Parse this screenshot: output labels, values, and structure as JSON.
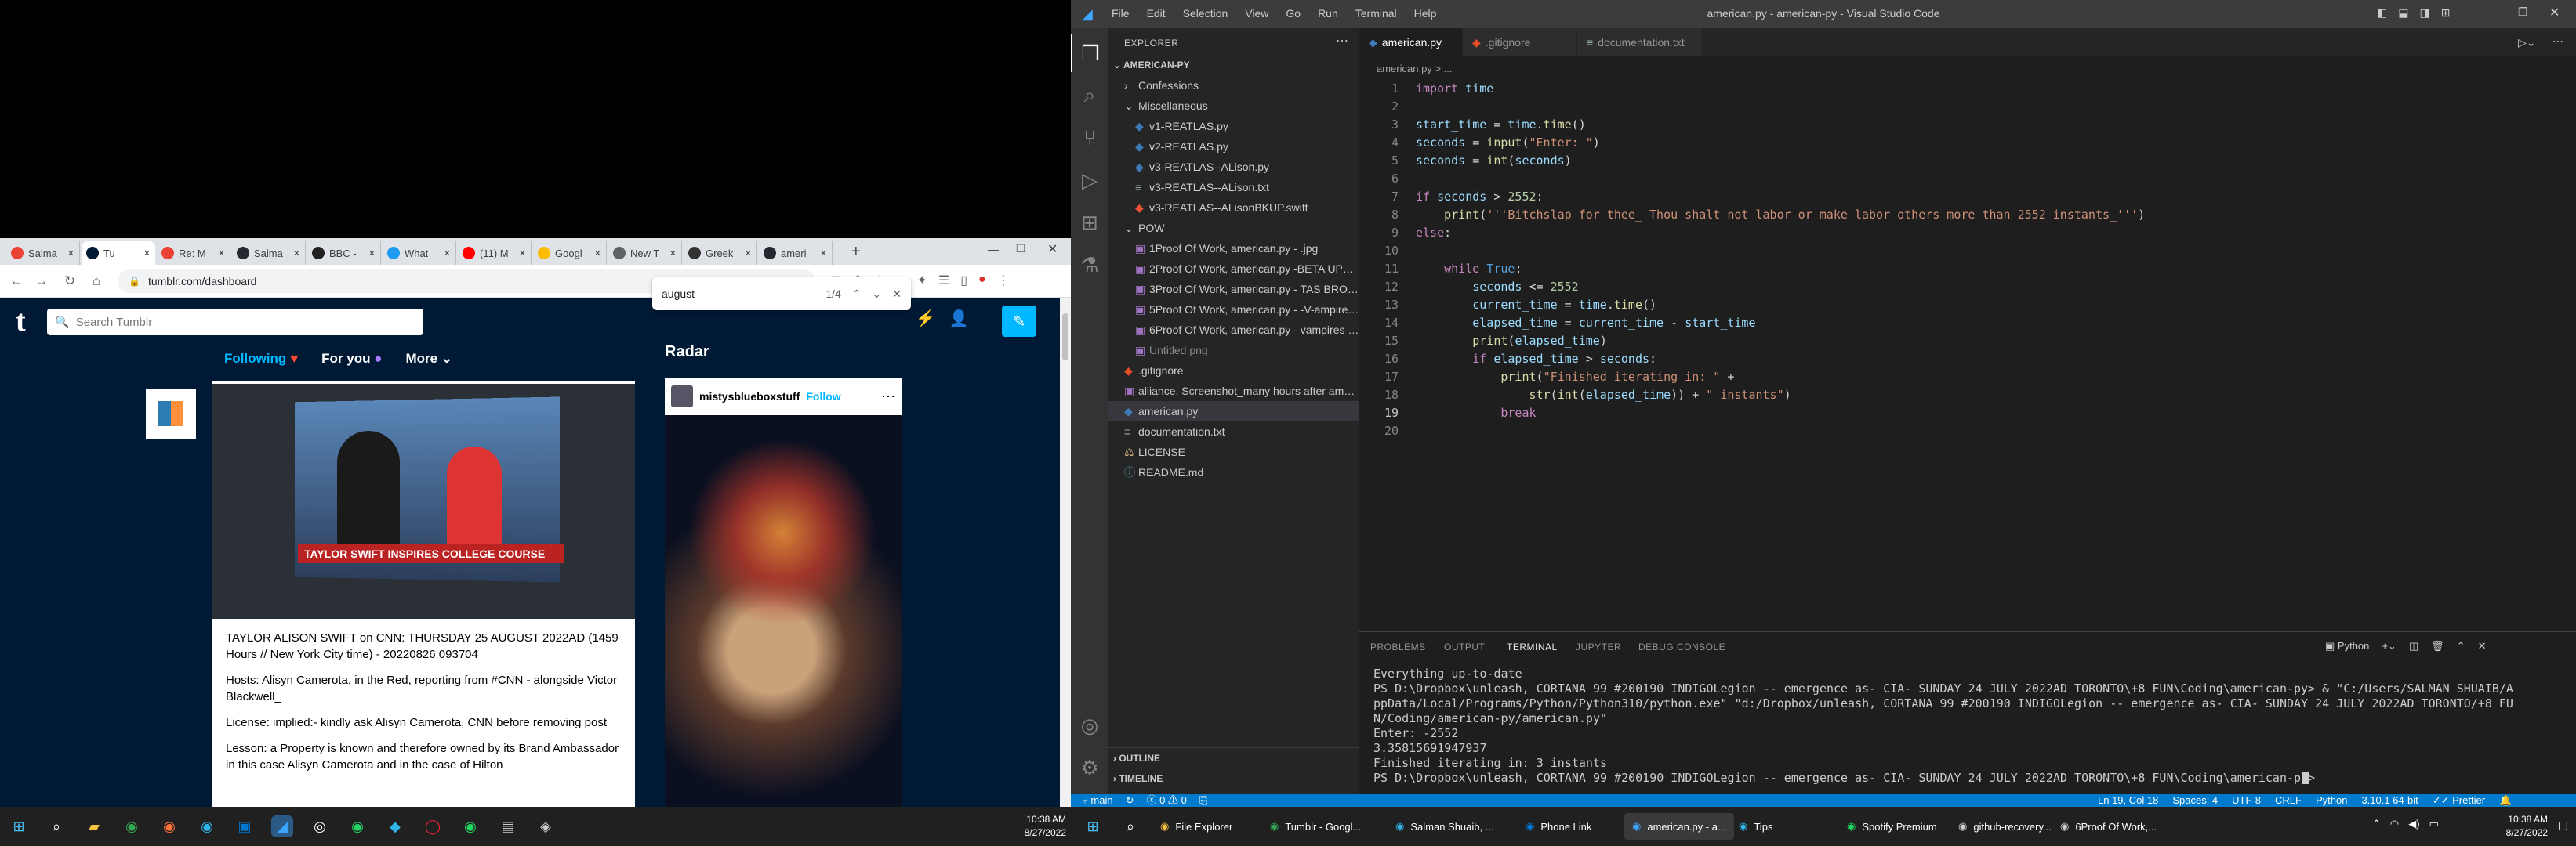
{
  "chrome": {
    "tabs": [
      {
        "label": "Salma",
        "color": "#ea4335"
      },
      {
        "label": "Tu",
        "color": "#001935"
      },
      {
        "label": "Re: M",
        "color": "#ea4335"
      },
      {
        "label": "Salma",
        "color": "#24292f"
      },
      {
        "label": "BBC -",
        "color": "#222"
      },
      {
        "label": "What",
        "color": "#1d9bf0"
      },
      {
        "label": "(11) M",
        "color": "#ff0000"
      },
      {
        "label": "Googl",
        "color": "#fbbc04"
      },
      {
        "label": "New T",
        "color": "#5f6368"
      },
      {
        "label": "Greek",
        "color": "#333"
      },
      {
        "label": "ameri",
        "color": "#24292f"
      }
    ],
    "new_tab": "+",
    "url": "tumblr.com/dashboard",
    "find": {
      "query": "august",
      "count": "1/4"
    }
  },
  "tumblr": {
    "search_placeholder": "Search Tumblr",
    "nav": {
      "following": "Following",
      "for_you": "For you",
      "more": "More"
    },
    "radar_title": "Radar",
    "radar_user": "mistysblueboxstuff",
    "radar_follow": "Follow",
    "tv_banner": "TAYLOR SWIFT INSPIRES COLLEGE COURSE",
    "post_paragraphs": [
      "TAYLOR ALISON SWIFT on CNN: THURSDAY 25 AUGUST 2022AD (1459 Hours // New York City time) - 20220826 093704",
      "Hosts: Alisyn Camerota, in the Red, reporting from #CNN - alongside Victor Blackwell_",
      "License: implied:- kindly ask Alisyn Camerota, CNN before removing post_",
      "Lesson: a Property is known and therefore owned by its Brand Ambassador in this case Alisyn Camerota and in the case of Hilton"
    ]
  },
  "left_taskbar": {
    "time": "10:38 AM",
    "date": "8/27/2022"
  },
  "vscode": {
    "menu": [
      "File",
      "Edit",
      "Selection",
      "View",
      "Go",
      "Run",
      "Terminal",
      "Help"
    ],
    "title": "american.py - american-py - Visual Studio Code",
    "explorer_title": "EXPLORER",
    "root": "AMERICAN-PY",
    "tree": [
      {
        "label": "Confessions",
        "indent": 1,
        "kind": "folder-closed",
        "color": "#cccccc"
      },
      {
        "label": "Miscellaneous",
        "indent": 1,
        "kind": "folder-open",
        "color": "#cccccc"
      },
      {
        "label": "v1-REATLAS.py",
        "indent": 2,
        "kind": "py",
        "color": "#cccccc"
      },
      {
        "label": "v2-REATLAS.py",
        "indent": 2,
        "kind": "py",
        "color": "#cccccc"
      },
      {
        "label": "v3-REATLAS--ALison.py",
        "indent": 2,
        "kind": "py",
        "color": "#cccccc"
      },
      {
        "label": "v3-REATLAS--ALison.txt",
        "indent": 2,
        "kind": "txt",
        "color": "#cccccc"
      },
      {
        "label": "v3-REATLAS--ALisonBKUP.swift",
        "indent": 2,
        "kind": "swift",
        "color": "#cccccc"
      },
      {
        "label": "POW",
        "indent": 1,
        "kind": "folder-open",
        "color": "#cccccc"
      },
      {
        "label": "1Proof Of Work, american.py - .jpg",
        "indent": 2,
        "kind": "img",
        "color": "#cccccc"
      },
      {
        "label": "2Proof Of Work, american.py -BETA UPDAT...",
        "indent": 2,
        "kind": "img",
        "color": "#cccccc"
      },
      {
        "label": "3Proof Of Work, american.py - TAS BRONZ...",
        "indent": 2,
        "kind": "img",
        "color": "#cccccc"
      },
      {
        "label": "5Proof Of Work, american.py - -V-ampires j...",
        "indent": 2,
        "kind": "img",
        "color": "#cccccc"
      },
      {
        "label": "6Proof Of Work, american.py - vampires m...",
        "indent": 2,
        "kind": "img",
        "color": "#cccccc"
      },
      {
        "label": "Untitled.png",
        "indent": 2,
        "kind": "img",
        "color": "#8c8c8c"
      },
      {
        "label": ".gitignore",
        "indent": 1,
        "kind": "git",
        "color": "#cccccc"
      },
      {
        "label": "alliance, Screenshot_many hours after ameri...",
        "indent": 1,
        "kind": "img",
        "color": "#cccccc"
      },
      {
        "label": "american.py",
        "indent": 1,
        "kind": "py",
        "color": "#cccccc"
      },
      {
        "label": "documentation.txt",
        "indent": 1,
        "kind": "txt",
        "color": "#cccccc"
      },
      {
        "label": "LICENSE",
        "indent": 1,
        "kind": "lic",
        "color": "#cccccc"
      },
      {
        "label": "README.md",
        "indent": 1,
        "kind": "md",
        "color": "#cccccc"
      }
    ],
    "outline": "OUTLINE",
    "timeline": "TIMELINE",
    "tabs": [
      {
        "label": "american.py",
        "active": true
      },
      {
        "label": ".gitignore",
        "active": false
      },
      {
        "label": "documentation.txt",
        "active": false
      }
    ],
    "breadcrumb": "american.py > ...",
    "code": [
      "import time",
      "",
      "start_time = time.time()",
      "seconds = input(\"Enter: \")",
      "seconds = int(seconds)",
      "",
      "if seconds > 2552:",
      "    print('''Bitchslap for thee_ Thou shalt not labor or make labor others more than 2552 instants_''')",
      "else:",
      "",
      "    while True:",
      "        seconds <= 2552",
      "        current_time = time.time()",
      "        elapsed_time = current_time - start_time",
      "        print(elapsed_time)",
      "        if elapsed_time > seconds:",
      "            print(\"Finished iterating in: \" +",
      "                str(int(elapsed_time)) + \" instants\")",
      "            break",
      ""
    ],
    "panel_tabs": [
      "PROBLEMS",
      "OUTPUT",
      "TERMINAL",
      "JUPYTER",
      "DEBUG CONSOLE"
    ],
    "terminal_kind": "Python",
    "terminal": [
      "Everything up-to-date",
      "PS D:\\Dropbox\\unleash, CORTANA 99 #200190 INDIGOLegion -- emergence as- CIA- SUNDAY 24 JULY 2022AD TORONTO\\+8 FUN\\Coding\\american-py> & \"C:/Users/SALMAN SHUAIB/A",
      "ppData/Local/Programs/Python/Python310/python.exe\" \"d:/Dropbox/unleash, CORTANA 99 #200190 INDIGOLegion -- emergence as- CIA- SUNDAY 24 JULY 2022AD TORONTO/+8 FU",
      "N/Coding/american-py/american.py\"",
      "Enter: -2552",
      "3.35815691947937",
      "Finished iterating in: 3 instants",
      "PS D:\\Dropbox\\unleash, CORTANA 99 #200190 INDIGOLegion -- emergence as- CIA- SUNDAY 24 JULY 2022AD TORONTO\\+8 FUN\\Coding\\american-py> "
    ],
    "status": {
      "branch": "main",
      "problems": "ⓧ 0 ⚠ 0",
      "cursor": "Ln 19, Col 18",
      "spaces": "Spaces: 4",
      "encoding": "UTF-8",
      "eol": "CRLF",
      "lang": "Python",
      "interpreter": "3.10.1 64-bit",
      "prettier": "Prettier"
    }
  },
  "right_taskbar": {
    "apps": [
      "File Explorer",
      "Tumblr - Googl...",
      "Salman Shuaib, ...",
      "Phone Link",
      "american.py - a...",
      "Tips",
      "Spotify Premium",
      "github-recovery...",
      "6Proof Of Work,..."
    ],
    "time": "10:38 AM",
    "date": "8/27/2022"
  }
}
